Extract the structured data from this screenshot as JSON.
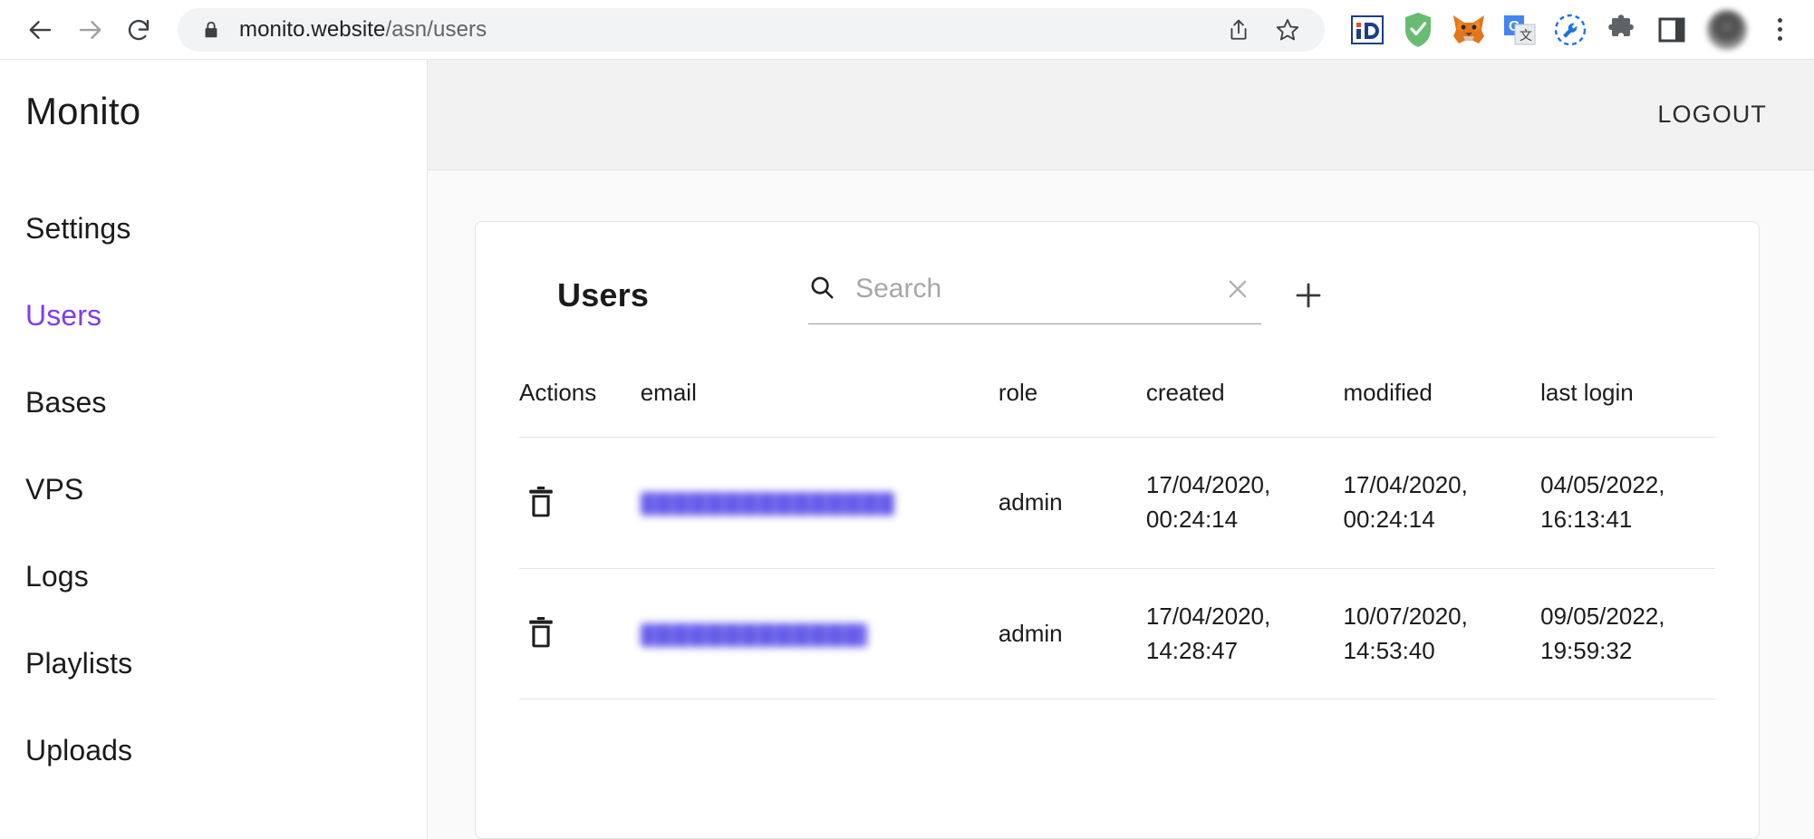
{
  "browser": {
    "back_icon": "arrow-left-icon",
    "forward_icon": "arrow-right-icon",
    "reload_icon": "reload-icon",
    "lock_icon": "lock-icon",
    "url_domain": "monito.website",
    "url_path": "/asn/users",
    "share_icon": "share-icon",
    "bookmark_icon": "star-icon",
    "extensions": [
      {
        "name": "ideal-extension-icon",
        "label": "iD"
      },
      {
        "name": "adguard-shield-icon",
        "label": ""
      },
      {
        "name": "metamask-fox-icon",
        "label": ""
      },
      {
        "name": "google-translate-icon",
        "label": "G"
      },
      {
        "name": "devtools-wrench-icon",
        "label": ""
      },
      {
        "name": "extensions-puzzle-icon",
        "label": ""
      },
      {
        "name": "side-panel-icon",
        "label": ""
      }
    ],
    "avatar_icon": "profile-avatar",
    "menu_icon": "kebab-menu-icon"
  },
  "sidebar": {
    "brand": "Monito",
    "items": [
      {
        "label": "Settings",
        "active": false
      },
      {
        "label": "Users",
        "active": true
      },
      {
        "label": "Bases",
        "active": false
      },
      {
        "label": "VPS",
        "active": false
      },
      {
        "label": "Logs",
        "active": false
      },
      {
        "label": "Playlists",
        "active": false
      },
      {
        "label": "Uploads",
        "active": false
      }
    ],
    "active_color": "#7d3df3"
  },
  "topbar": {
    "logout_label": "LOGOUT"
  },
  "card": {
    "title": "Users",
    "search": {
      "placeholder": "Search",
      "value": "",
      "search_icon": "search-icon",
      "clear_icon": "close-icon"
    },
    "add_icon": "plus-icon"
  },
  "table": {
    "columns": [
      "Actions",
      "email",
      "role",
      "created",
      "modified",
      "last login"
    ],
    "rows": [
      {
        "delete_icon": "trash-icon",
        "email": "",
        "email_redacted": true,
        "role": "admin",
        "created": "17/04/2020,\n00:24:14",
        "modified": "17/04/2020,\n00:24:14",
        "last_login": "04/05/2022,\n16:13:41"
      },
      {
        "delete_icon": "trash-icon",
        "email": "",
        "email_redacted": true,
        "role": "admin",
        "created": "17/04/2020,\n14:28:47",
        "modified": "10/07/2020,\n14:53:40",
        "last_login": "09/05/2022,\n19:59:32"
      }
    ]
  }
}
